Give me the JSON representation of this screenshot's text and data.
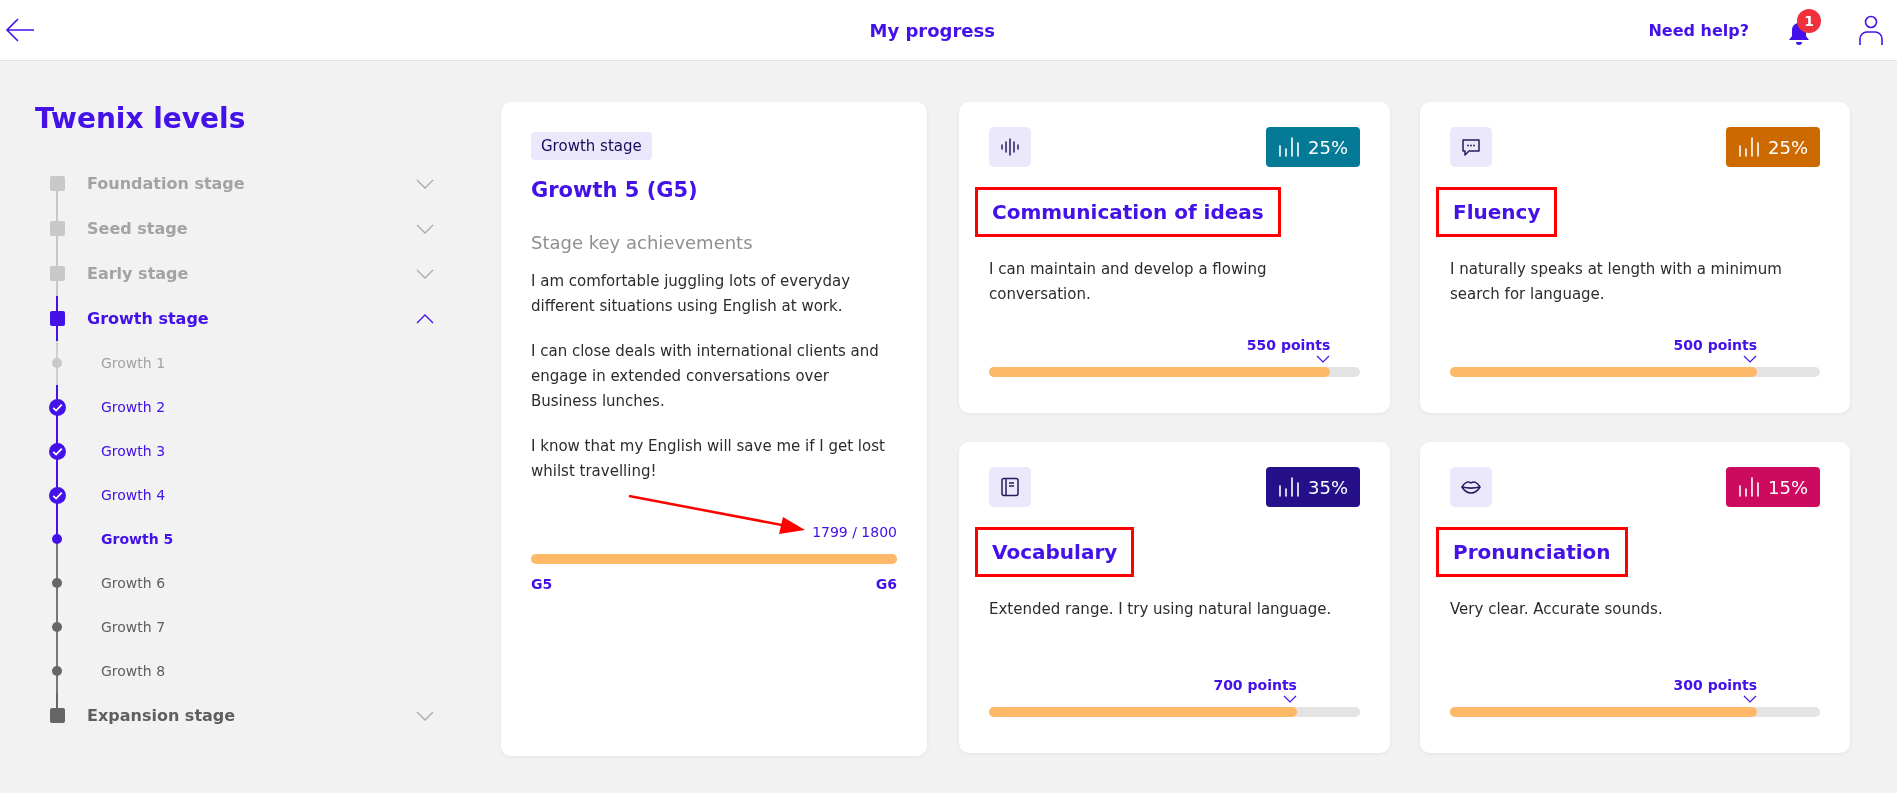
{
  "header": {
    "title": "My progress",
    "help_link": "Need help?",
    "notification_count": "1"
  },
  "sidebar": {
    "title": "Twenix levels",
    "stages": [
      {
        "label": "Foundation stage",
        "locked": true,
        "current": false,
        "expanded": false
      },
      {
        "label": "Seed stage",
        "locked": true,
        "current": false,
        "expanded": false
      },
      {
        "label": "Early stage",
        "locked": true,
        "current": false,
        "expanded": false
      },
      {
        "label": "Growth stage",
        "locked": false,
        "current": true,
        "expanded": true,
        "children": [
          {
            "label": "Growth 1",
            "locked": true,
            "completed": false,
            "current": false
          },
          {
            "label": "Growth 2",
            "locked": false,
            "completed": true,
            "current": false
          },
          {
            "label": "Growth 3",
            "locked": false,
            "completed": true,
            "current": false
          },
          {
            "label": "Growth 4",
            "locked": false,
            "completed": true,
            "current": false
          },
          {
            "label": "Growth 5",
            "locked": false,
            "completed": false,
            "current": true
          },
          {
            "label": "Growth 6",
            "locked": false,
            "completed": false,
            "current": false
          },
          {
            "label": "Growth 7",
            "locked": false,
            "completed": false,
            "current": false
          },
          {
            "label": "Growth 8",
            "locked": false,
            "completed": false,
            "current": false
          }
        ]
      },
      {
        "label": "Expansion stage",
        "locked": false,
        "current": false,
        "expanded": false
      }
    ]
  },
  "level_card": {
    "tag": "Growth stage",
    "title": "Growth 5 (G5)",
    "subtitle": "Stage key achievements",
    "achievements": [
      "I am comfortable juggling lots of everyday different situations using English at work.",
      "I can close deals with international clients and engage in extended conversations over Business lunches.",
      "I know that my English will save me if I get lost whilst travelling!"
    ],
    "progress_reading": "1799 / 1800",
    "level": 0.999,
    "start_label": "G5",
    "end_label": "G6"
  },
  "skills": [
    {
      "kind": "communication",
      "title": "Communication of ideas",
      "percent": "25%",
      "color": "#047a96",
      "highlighted": true,
      "description": "I can maintain and develop a flowing conversation.",
      "points": "550 points",
      "level": 0.92
    },
    {
      "kind": "fluency",
      "title": "Fluency",
      "percent": "25%",
      "color": "#cc6a00",
      "highlighted": true,
      "description": "I naturally speaks at length with a minimum search for language.",
      "points": "500 points",
      "level": 0.83
    },
    {
      "kind": "vocabulary",
      "title": "Vocabulary",
      "percent": "35%",
      "color": "#25108a",
      "highlighted": true,
      "description": "Extended range. I try using natural language.",
      "points": "700 points",
      "level": 0.83
    },
    {
      "kind": "pronunciation",
      "title": "Pronunciation",
      "percent": "15%",
      "color": "#cc0a5e",
      "highlighted": true,
      "description": "Very clear. Accurate sounds.",
      "points": "300 points",
      "level": 0.83
    }
  ]
}
